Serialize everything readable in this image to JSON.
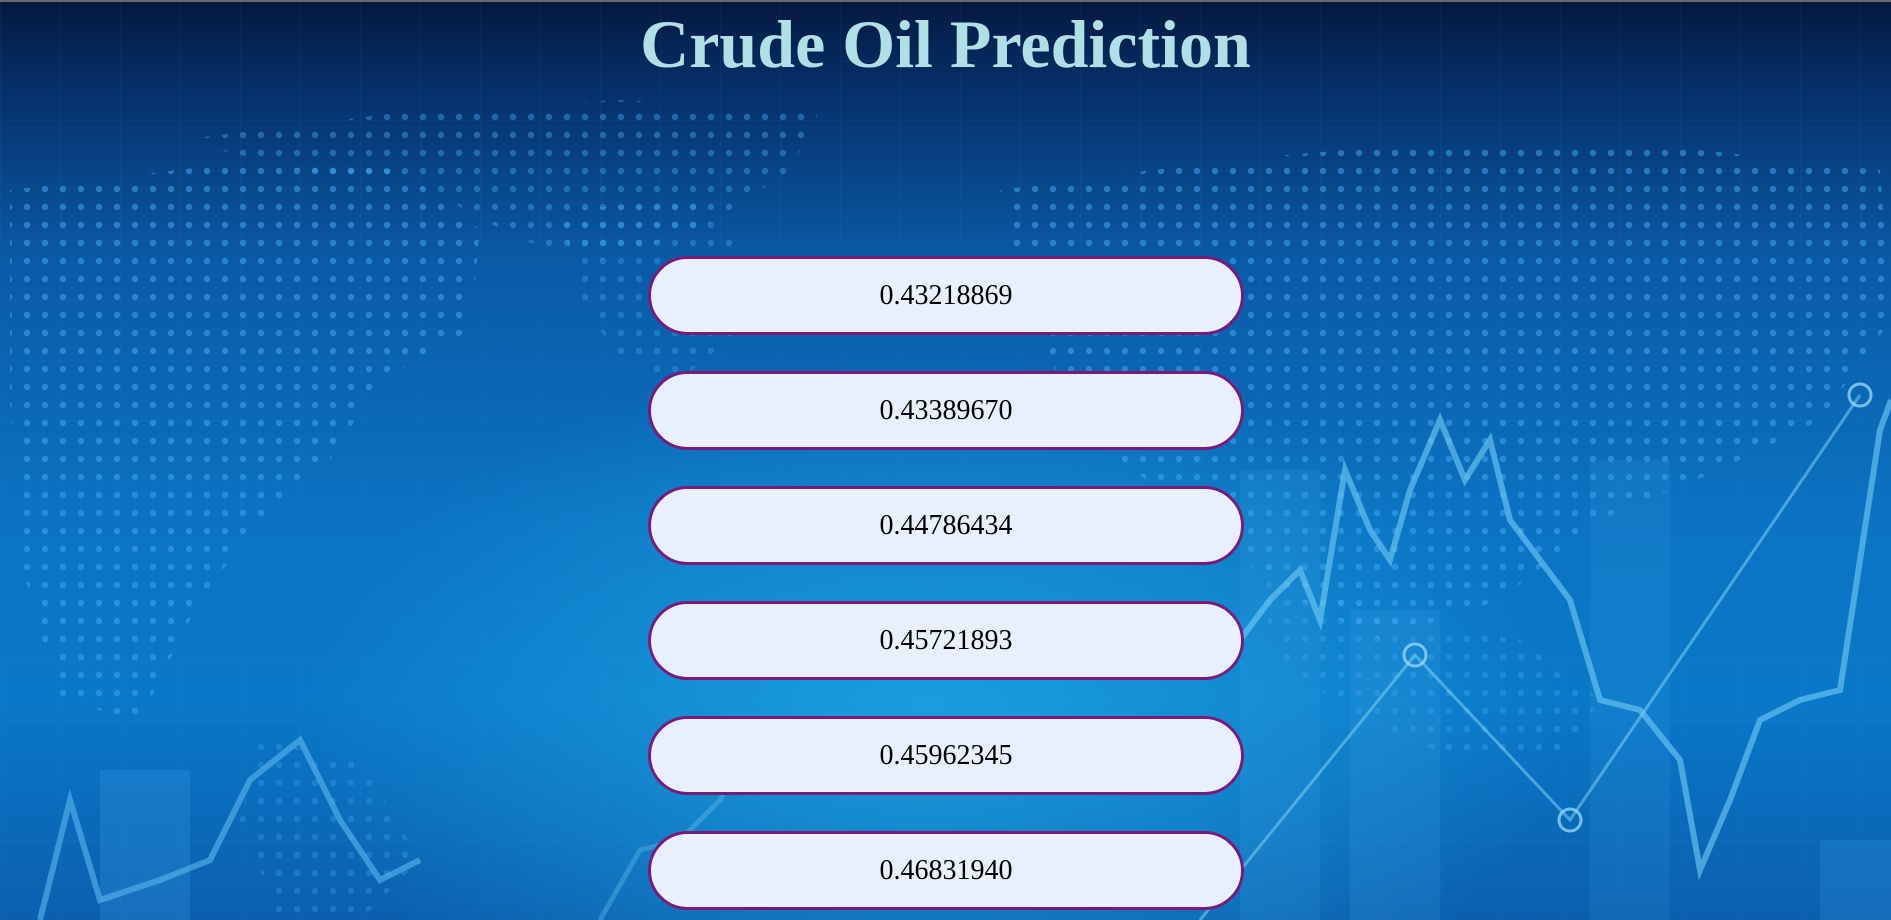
{
  "page": {
    "title": "Crude Oil Prediction"
  },
  "predictions": [
    "0.43218869",
    "0.43389670",
    "0.44786434",
    "0.45721893",
    "0.45962345",
    "0.46831940"
  ],
  "colors": {
    "title": "#b0e0e6",
    "pill_fill": "#e8f0fe",
    "pill_border": "#7a1a7a",
    "background_dark": "#04193f",
    "background_light": "#0b73c2"
  }
}
